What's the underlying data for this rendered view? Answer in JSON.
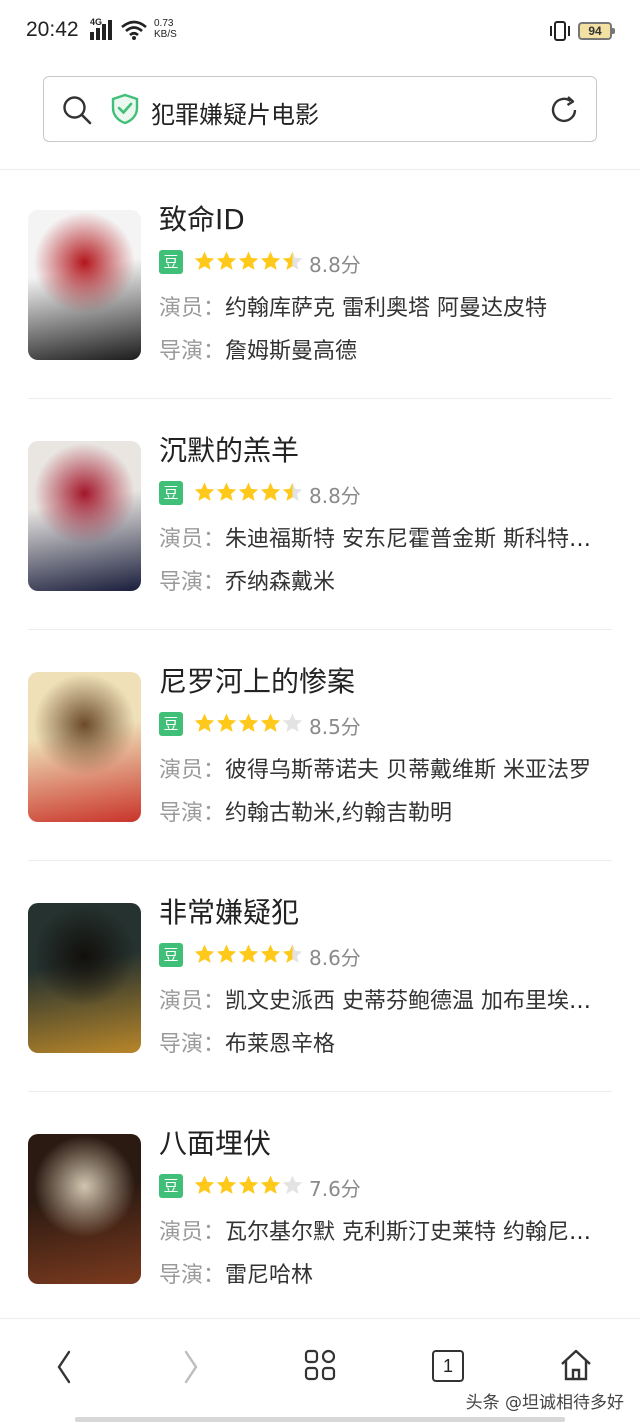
{
  "status_bar": {
    "time": "20:42",
    "network": "4G",
    "speed_value": "0.73",
    "speed_unit": "KB/S",
    "battery": "94"
  },
  "search": {
    "query": "犯罪嫌疑片电影"
  },
  "movies": [
    {
      "title": "致命ID",
      "rating_stars": 4.5,
      "score": "8.8分",
      "cast_label": "演员：",
      "cast": "约翰库萨克  雷利奥塔  阿曼达皮特",
      "director_label": "导演：",
      "director": "詹姆斯曼高德",
      "poster_colors": [
        "#f4f4f4",
        "#1c1c1c",
        "#b3161c"
      ]
    },
    {
      "title": "沉默的羔羊",
      "rating_stars": 4.5,
      "score": "8.8分",
      "cast_label": "演员：",
      "cast": "朱迪福斯特  安东尼霍普金斯  斯科特格伦",
      "director_label": "导演：",
      "director": "乔纳森戴米",
      "poster_colors": [
        "#e9e6e2",
        "#1a1e3c",
        "#a3162a"
      ]
    },
    {
      "title": "尼罗河上的惨案",
      "rating_stars": 4,
      "score": "8.5分",
      "cast_label": "演员：",
      "cast": "彼得乌斯蒂诺夫  贝蒂戴维斯  米亚法罗",
      "director_label": "导演：",
      "director": "约翰古勒米,约翰吉勒明",
      "poster_colors": [
        "#efe0b8",
        "#c9342a",
        "#6b4a2a"
      ]
    },
    {
      "title": "非常嫌疑犯",
      "rating_stars": 4.5,
      "score": "8.6分",
      "cast_label": "演员：",
      "cast": "凯文史派西  史蒂芬鲍德温  加布里埃尔拜恩",
      "director_label": "导演：",
      "director": "布莱恩辛格",
      "poster_colors": [
        "#25322f",
        "#b8862a",
        "#120f0c"
      ]
    },
    {
      "title": "八面埋伏",
      "rating_stars": 4,
      "score": "7.6分",
      "cast_label": "演员：",
      "cast": "瓦尔基尔默  克利斯汀史莱特  约翰尼李米勒",
      "director_label": "导演：",
      "director": "雷尼哈林",
      "poster_colors": [
        "#2b1a12",
        "#7b3a1e",
        "#d2c6b0"
      ]
    }
  ],
  "bottom_nav": {
    "tabs_count": "1"
  },
  "watermark": "头条 @坦诚相待多好",
  "colors": {
    "douban_green": "#3fbf77",
    "star_yellow": "#ffc91b",
    "star_empty": "#e3e3e3",
    "shield_green": "#3fbf77"
  }
}
